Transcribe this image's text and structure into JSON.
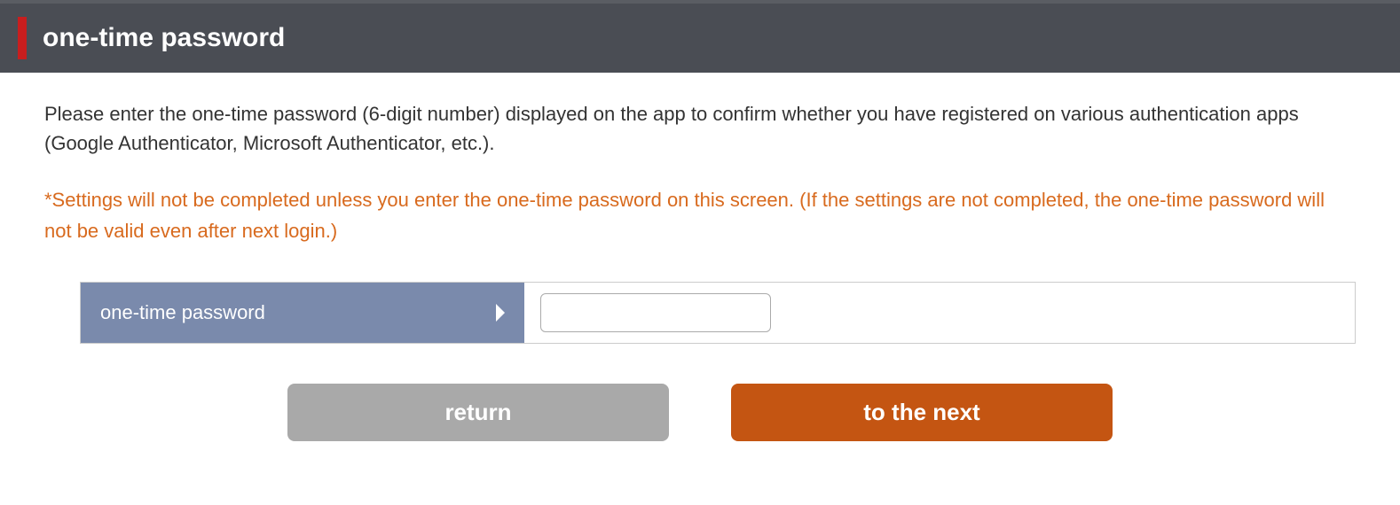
{
  "header": {
    "title": "one-time password"
  },
  "content": {
    "instruction": "Please enter the one-time password (6-digit number) displayed on the app to confirm whether you have registered on various authentication apps (Google Authenticator, Microsoft Authenticator, etc.).",
    "warning": "*Settings will not be completed unless you enter the one-time password on this screen. (If the settings are not completed, the one-time password will not be valid even after next login.)"
  },
  "form": {
    "label": "one-time password",
    "value": ""
  },
  "buttons": {
    "return": "return",
    "next": "to the next"
  }
}
